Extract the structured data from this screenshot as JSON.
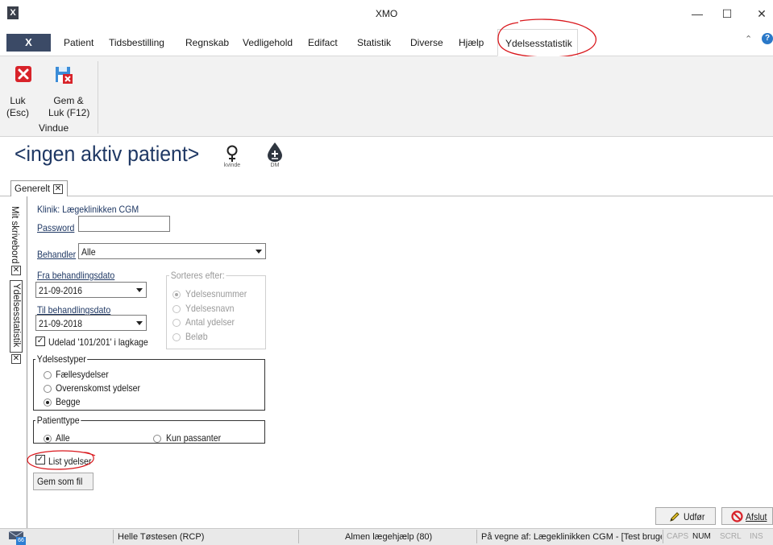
{
  "window": {
    "title": "XMO",
    "app_icon": "X",
    "minimize": "—",
    "maximize": "☐",
    "close": "✕"
  },
  "menu": {
    "file_tab": "X",
    "tabs": [
      "Patient",
      "Tidsbestilling",
      "Regnskab",
      "Vedligehold",
      "Edifact",
      "Statistik",
      "Diverse",
      "Hjælp"
    ],
    "active_tab": "Ydelsesstatistik",
    "collapse_icon": "⌃",
    "help_icon": "?"
  },
  "ribbon": {
    "close_label": "Luk\n(Esc)",
    "save_close_label": "Gem &\nLuk (F12)",
    "group_label": "Vindue"
  },
  "patient": {
    "title": "<ingen aktiv patient>",
    "gender_caption": "kvinde",
    "dm_caption": "DM"
  },
  "doc_tab": {
    "label": "Generelt"
  },
  "side_tabs": [
    "Mit skrivebord",
    "Ydelsesstatistik"
  ],
  "form": {
    "clinic": "Klinik: Lægeklinikken CGM",
    "password_label": "Password",
    "password_value": "",
    "behandler_label": "Behandler",
    "behandler_value": "Alle",
    "fra_label": "Fra behandlingsdato",
    "fra_value": "21-09-2016",
    "til_label": "Til behandlingsdato",
    "til_value": "21-09-2018",
    "udelad_label": "Udelad '101/201' i lagkage",
    "udelad_checked": true,
    "sorteres_legend": "Sorteres efter:",
    "sort_options": [
      "Ydelsesnummer",
      "Ydelsesnavn",
      "Antal ydelser",
      "Beløb"
    ],
    "sort_selected": 0,
    "ydelsestyper_legend": "Ydelsestyper",
    "ydelsestyper_options": [
      "Fællesydelser",
      "Overenskomst ydelser",
      "Begge"
    ],
    "ydelsestyper_selected": 2,
    "patienttype_legend": "Patienttype",
    "patienttype_options": [
      "Alle",
      "Kun passanter"
    ],
    "patienttype_selected": 0,
    "list_label": "List ydelser",
    "list_checked": true,
    "save_file_button": "Gem som fil",
    "run_button": "Udfør",
    "exit_button": "Afslut"
  },
  "statusbar": {
    "user": "Helle Tøstesen  (RCP)",
    "practice": "Almen lægehjælp (80)",
    "on_behalf": "På vegne af: Lægeklinikken CGM - [Test bruge",
    "caps": "CAPS",
    "num": "NUM",
    "scrl": "SCRL",
    "ins": "INS",
    "message_badge": "66"
  },
  "colors": {
    "annotation": "#d9171c",
    "accent_blue": "#1f3864",
    "file_tab_bg": "#3b4a66"
  }
}
